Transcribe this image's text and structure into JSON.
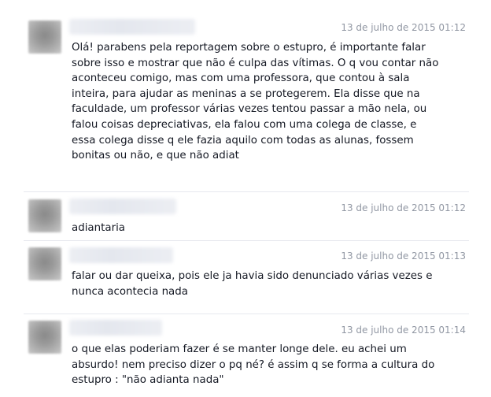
{
  "messages": [
    {
      "timestamp": "13 de julho de 2015 01:12",
      "text": "Olá! parabens pela reportagem sobre o estupro, é importante falar\nsobre isso e mostrar que não é culpa das vítimas. O q vou contar não\naconteceu comigo, mas com uma professora, que contou à sala\ninteira, para ajudar as meninas a se protegerem. Ela disse que na\nfaculdade, um professor várias vezes tentou passar a mão nela, ou\nfalou coisas depreciativas, ela falou com uma colega de classe, e\nessa colega disse q ele fazia aquilo com todas as alunas, fossem\nbonitas ou não, e que não adiat"
    },
    {
      "timestamp": "13 de julho de 2015 01:12",
      "text": "adiantaria"
    },
    {
      "timestamp": "13 de julho de 2015 01:13",
      "text": "falar ou dar queixa, pois ele ja havia sido denunciado várias vezes e\nnunca acontecia nada"
    },
    {
      "timestamp": "13 de julho de 2015 01:14",
      "text": "o que elas poderiam fazer é se manter longe dele. eu achei um\nabsurdo! nem preciso dizer o pq né? é assim q se forma a cultura do\nestupro : \"não adianta nada\""
    }
  ]
}
